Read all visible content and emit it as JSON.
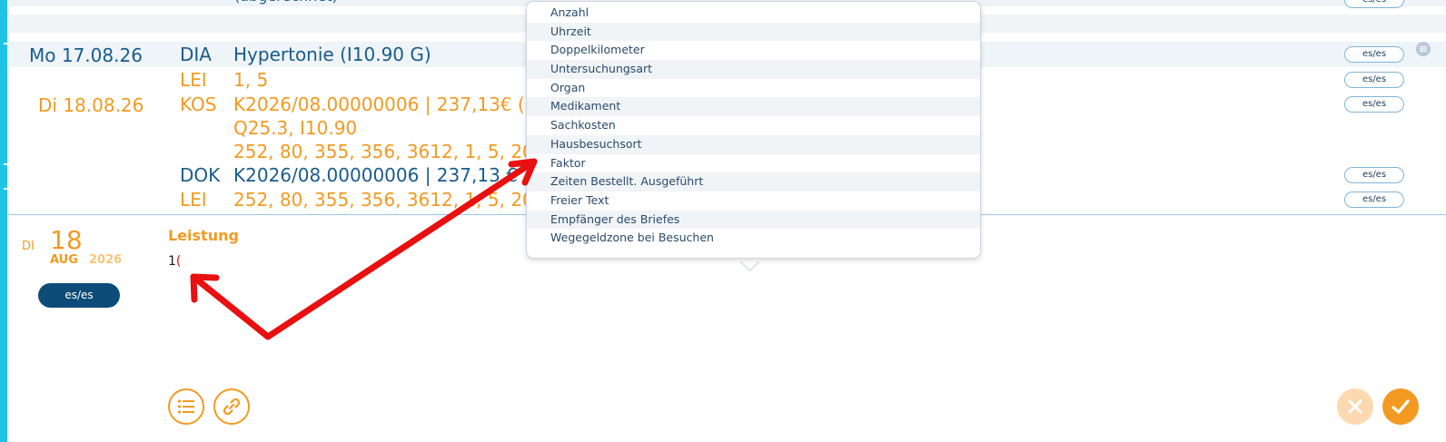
{
  "top_partial_text": "(abgerechnet)",
  "entries": {
    "date1": "Mo 17.08.26",
    "date2": "Di 18.08.26",
    "rows": [
      {
        "code": "DIA",
        "text": "Hypertonie (I10.90 G)",
        "color": "#1a5c8a"
      },
      {
        "code": "LEI",
        "text": "1, 5",
        "color": "#f39a22"
      },
      {
        "code": "KOS",
        "text": "K2026/08.00000006 | 237,13€ (abg",
        "color": "#f39a22"
      },
      {
        "code": "",
        "text": "Q25.3, I10.90",
        "color": "#f39a22"
      },
      {
        "code": "",
        "text": "252, 80, 355, 356, 3612, 1, 5, 200, 9",
        "color": "#f39a22"
      },
      {
        "code": "DOK",
        "text": "K2026/08.00000006 | 237,13 €",
        "color": "#1a5c8a"
      },
      {
        "code": "LEI",
        "text": "252, 80, 355, 356, 3612, 1, 5, 200, 9",
        "color": "#f39a22"
      }
    ],
    "pill_label": "es/es"
  },
  "dropdown": {
    "items": [
      "Anzahl",
      "Uhrzeit",
      "Doppelkilometer",
      "Untersuchungsart",
      "Organ",
      "Medikament",
      "Sachkosten",
      "Hausbesuchsort",
      "Faktor",
      "Zeiten Bestellt. Ausgeführt",
      "Freier Text",
      "Empfänger des Briefes",
      "Wegegeldzone bei Besuchen"
    ]
  },
  "editor": {
    "weekday": "DI",
    "day": "18",
    "month": "AUG",
    "year": "2026",
    "user_button": "es/es",
    "section_label": "Leistung",
    "input_prefix": "1",
    "input_paren": "("
  },
  "colors": {
    "accent_orange": "#f39a22",
    "dark_blue": "#1a5c8a",
    "cyan_bar": "#1fc4e4",
    "annotation_red": "#e81010"
  },
  "icons": {
    "list": "list-icon",
    "link": "link-icon",
    "cancel": "close-icon",
    "confirm": "checkmark-icon",
    "comment": "comment-icon"
  }
}
